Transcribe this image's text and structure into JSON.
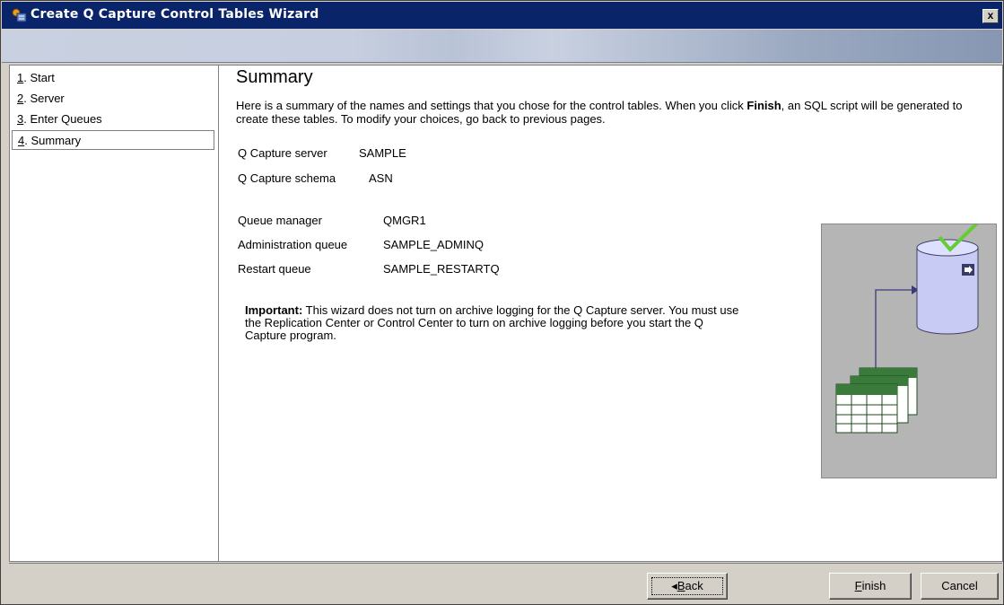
{
  "window": {
    "title": "Create Q Capture Control Tables Wizard",
    "close_label": "x"
  },
  "nav": {
    "items": [
      {
        "num": "1",
        "label": ". Start",
        "selected": false
      },
      {
        "num": "2",
        "label": ". Server",
        "selected": false
      },
      {
        "num": "3",
        "label": ". Enter Queues",
        "selected": false
      },
      {
        "num": "4",
        "label": ". Summary",
        "selected": true
      }
    ]
  },
  "main": {
    "heading": "Summary",
    "intro_part1": "Here is a summary of the names and settings that you chose for the control tables.  When you click ",
    "intro_bold": "Finish",
    "intro_part2": ", an SQL script will be generated to create these tables.  To modify your choices, go back to previous pages.",
    "server_label": "Q Capture server",
    "server_value": "SAMPLE",
    "schema_label": "Q Capture schema",
    "schema_value": "ASN",
    "qmgr_label": "Queue manager",
    "qmgr_value": "QMGR1",
    "admin_label": "Administration queue",
    "admin_value": "SAMPLE_ADMINQ",
    "restart_label": "Restart queue",
    "restart_value": "SAMPLE_RESTARTQ",
    "note_bold": "Important:",
    "note_text": " This wizard does not turn on archive logging for the Q Capture server. You must use the Replication Center or Control Center to turn on archive logging before you start the Q Capture program."
  },
  "buttons": {
    "back_arrow": "◂",
    "back_mnemonic": "B",
    "back_rest": "ack",
    "finish_mnemonic": "F",
    "finish_rest": "inish",
    "cancel": "Cancel"
  },
  "icons": {
    "app": "wizard-app-icon",
    "database": "database-icon",
    "check": "checkmark-icon",
    "tables": "tables-stack-icon",
    "arrow": "connector-arrow-icon"
  },
  "colors": {
    "titlebar": "#0a246a",
    "dialog_bg": "#d4d0c8",
    "db_fill": "#c8ccf4",
    "check": "#66cc33",
    "table_header": "#3a7a3a"
  }
}
